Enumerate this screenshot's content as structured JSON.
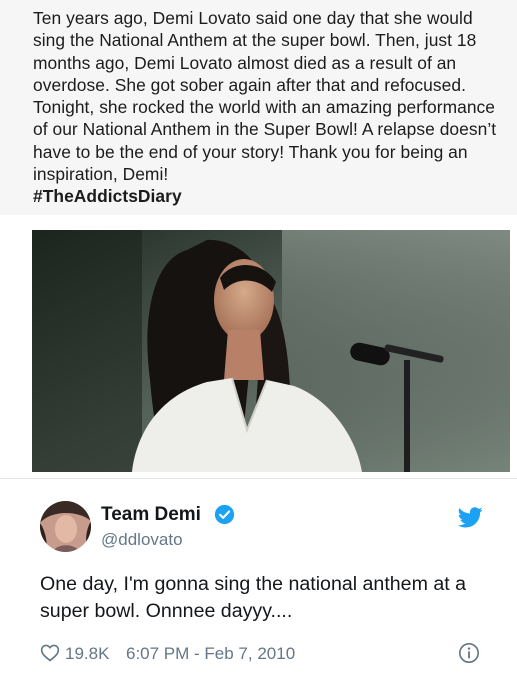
{
  "post": {
    "body": "Ten years ago, Demi Lovato said one day that she would sing the National Anthem at the super bowl. Then, just 18 months ago, Demi Lovato almost died as a result of an overdose. She got sober again after that and refocused. Tonight, she rocked the world with an amazing performance of our National Anthem in the Super Bowl! A relapse doesn’t have to be the end of your story! Thank you for being an inspiration, Demi!",
    "hashtag": "#TheAddictsDiary"
  },
  "tweet": {
    "display_name": "Team Demi",
    "handle": "@ddlovato",
    "text": "One day, I'm gonna sing the national anthem at a super bowl. Onnnee dayyy....",
    "likes": "19.8K",
    "timestamp": "6:07 PM - Feb 7, 2010",
    "icons": {
      "verified": "verified-badge-icon",
      "brand": "twitter-bird-icon",
      "like": "heart-icon",
      "info": "info-icon"
    }
  },
  "colors": {
    "post_background": "#f6f6f6",
    "text": "#1c1c1c",
    "twitter_blue": "#1da1f2",
    "secondary_text": "#657786"
  }
}
